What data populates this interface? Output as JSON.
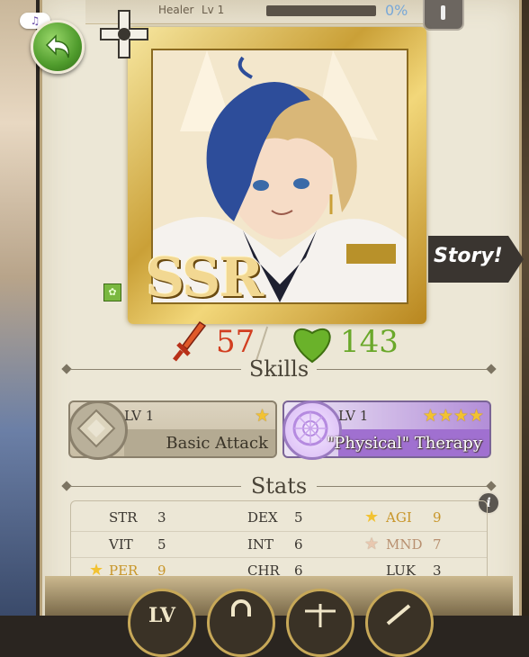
{
  "header": {
    "class_label": "Healer",
    "lv_label": "Lv",
    "lv_value": "1",
    "percent": "0%"
  },
  "music_icon": "music-note-icon",
  "card": {
    "rarity": "SSR",
    "story_label": "Story!"
  },
  "power": {
    "attack": "57",
    "hp": "143"
  },
  "skills": {
    "heading": "Skills",
    "items": [
      {
        "lv_label": "LV",
        "lv": "1",
        "stars": "★",
        "name": "Basic Attack"
      },
      {
        "lv_label": "LV",
        "lv": "1",
        "stars": "★★★★",
        "name": "\"Physical\" Therapy"
      }
    ]
  },
  "stats": {
    "heading": "Stats",
    "rows": [
      [
        {
          "label": "STR",
          "value": "3"
        },
        {
          "label": "DEX",
          "value": "5"
        },
        {
          "label": "AGI",
          "value": "9"
        }
      ],
      [
        {
          "label": "VIT",
          "value": "5"
        },
        {
          "label": "INT",
          "value": "6"
        },
        {
          "label": "MND",
          "value": "7"
        }
      ],
      [
        {
          "label": "PER",
          "value": "9"
        },
        {
          "label": "CHR",
          "value": "6"
        },
        {
          "label": "LUK",
          "value": "3"
        }
      ]
    ]
  },
  "bottom_nav": {
    "lv_label": "LV"
  },
  "colors": {
    "attack": "#d23e20",
    "hp": "#6aa82a",
    "gold": "#f2c232",
    "panel": "#ece7d6"
  }
}
